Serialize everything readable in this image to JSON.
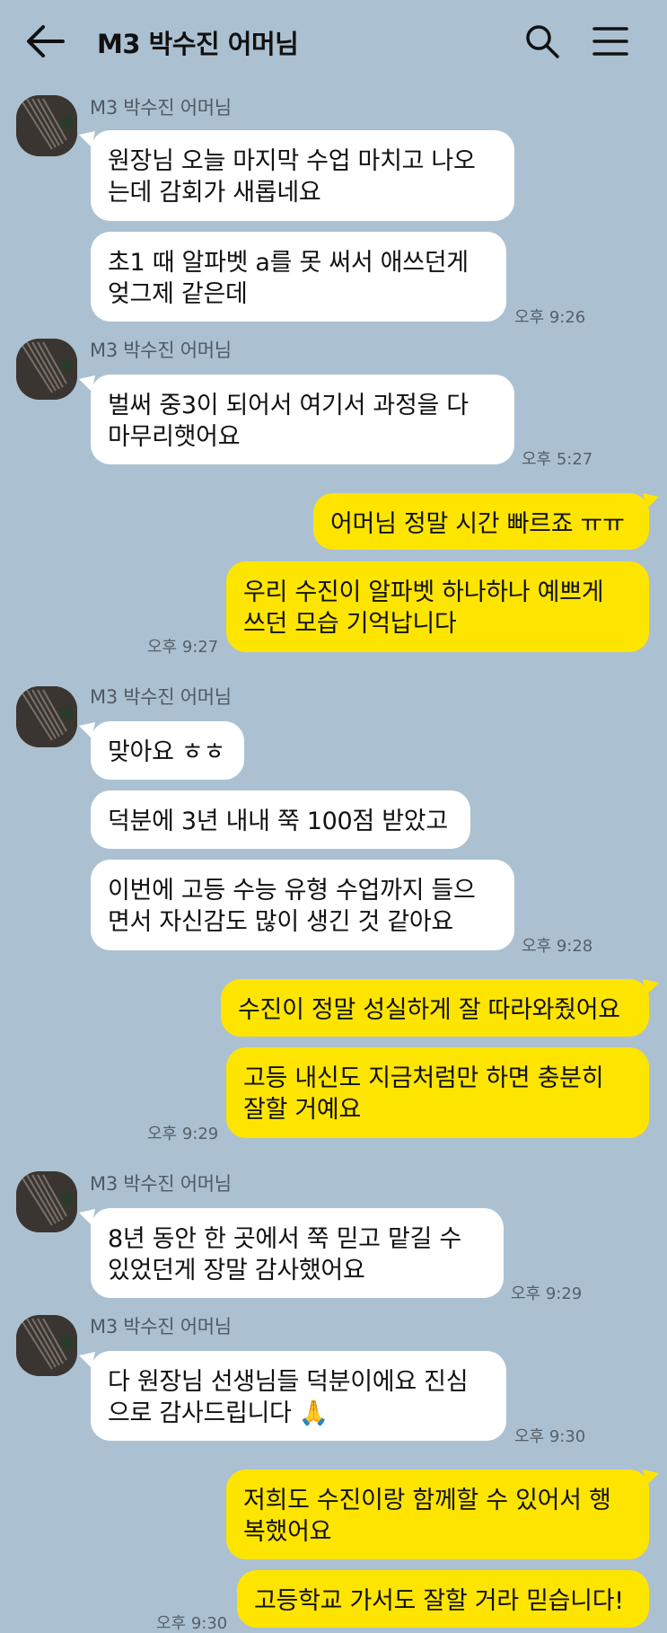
{
  "header": {
    "title": "M3 박수진 어머님",
    "back_icon": "back-arrow-icon",
    "search_icon": "search-icon",
    "menu_icon": "menu-icon"
  },
  "colors": {
    "background": "#abc1d1",
    "incoming_bubble": "#ffffff",
    "outgoing_bubble": "#fee500"
  },
  "messages": [
    {
      "direction": "in",
      "sender": "M3 박수진 어머님",
      "text": "원장님 오늘 마지막 수업 마치고 나오\n는데 감회가 새롭네요"
    },
    {
      "direction": "in",
      "text": "초1 때 알파벳 a를 못 써서 애쓰던게\n엊그제 같은데",
      "time": "오후 9:26"
    },
    {
      "direction": "in",
      "sender": "M3 박수진 어머님",
      "text": "벌써 중3이 되어서 여기서 과정을 다\n마무리햇어요",
      "time": "오후 5:27"
    },
    {
      "direction": "out",
      "text": "어머님 정말 시간 빠르죠 ㅠㅠ"
    },
    {
      "direction": "out",
      "text": "우리 수진이 알파벳 하나하나 예쁘게\n쓰던 모습 기억납니다",
      "time": "오후 9:27"
    },
    {
      "direction": "in",
      "sender": "M3 박수진 어머님",
      "text": "맞아요 ㅎㅎ"
    },
    {
      "direction": "in",
      "text": "덕분에 3년 내내 쭉 100점 받았고"
    },
    {
      "direction": "in",
      "text": "이번에 고등 수능 유형 수업까지 들으\n면서 자신감도 많이 생긴 것 같아요",
      "time": "오후 9:28"
    },
    {
      "direction": "out",
      "text": "수진이 정말 성실하게 잘 따라와줬어요"
    },
    {
      "direction": "out",
      "text": "고등 내신도 지금처럼만 하면 충분히\n잘할 거예요",
      "time": "오후 9:29"
    },
    {
      "direction": "in",
      "sender": "M3 박수진 어머님",
      "text": "8년 동안 한 곳에서 쭉 믿고 맡길 수\n있었던게 장말 감사했어요",
      "time": "오후 9:29"
    },
    {
      "direction": "in",
      "sender": "M3 박수진 어머님",
      "text": "다 원장님 선생님들 덕분이에요 진심\n으로 감사드립니다 🙏",
      "time": "오후 9:30"
    },
    {
      "direction": "out",
      "text": "저희도 수진이랑 함께할 수 있어서 행\n복했어요"
    },
    {
      "direction": "out",
      "text": "고등학교 가서도 잘할 거라 믿습니다!",
      "time": "오후 9:30"
    }
  ]
}
